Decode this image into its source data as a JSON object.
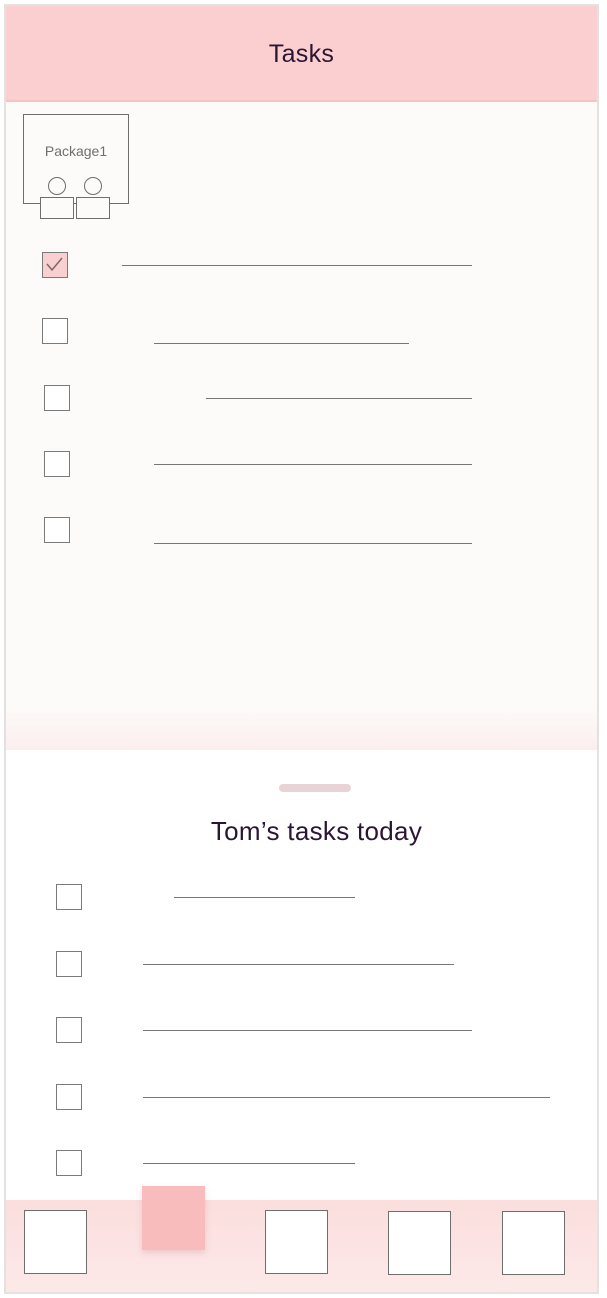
{
  "header": {
    "title": "Tasks"
  },
  "package": {
    "label": "Package1"
  },
  "task_list": [
    {
      "checked": true
    },
    {
      "checked": false
    },
    {
      "checked": false
    },
    {
      "checked": false
    },
    {
      "checked": false
    }
  ],
  "sheet": {
    "title": "Tom’s tasks today"
  },
  "toms_tasks": [
    {
      "checked": false
    },
    {
      "checked": false
    },
    {
      "checked": false
    },
    {
      "checked": false
    },
    {
      "checked": false
    }
  ],
  "bottom_nav": {
    "active_index": 1,
    "item_count": 5
  },
  "colors": {
    "accent": "#fbcfcf",
    "checked_fill": "#f9cfcf",
    "nav_active": "#f9bcbc",
    "title_text": "#2a1633"
  }
}
